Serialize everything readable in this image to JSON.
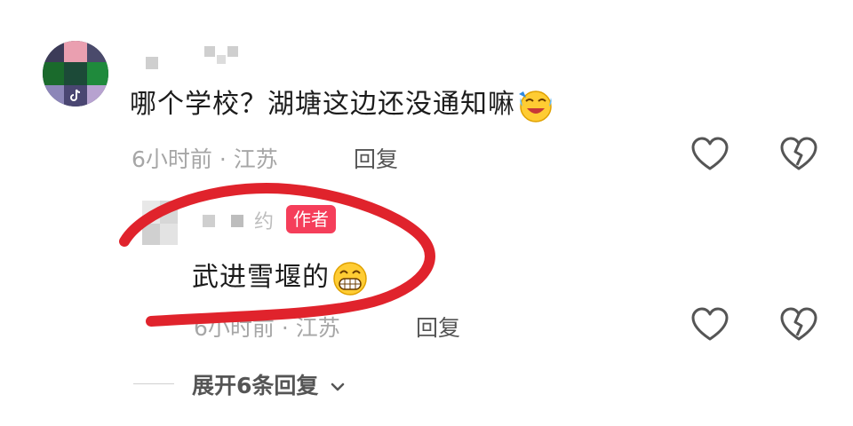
{
  "comment1": {
    "text": "哪个学校？湖塘这边还没通知嘛",
    "emoji": "laughing-crying-emoji",
    "time": "6小时前",
    "location": "江苏",
    "separator": "·",
    "reply_label": "回复"
  },
  "comment2": {
    "username_fragment": "约",
    "badge": "作者",
    "text": "武进雪堰的",
    "emoji": "grinning-emoji",
    "time": "6小时前",
    "separator": "·",
    "location": "江苏",
    "reply_label": "回复"
  },
  "expand": {
    "label": "展开6条回复",
    "icon": "chevron-down-icon"
  },
  "colors": {
    "badge": "#f53e5a",
    "annotation_stroke": "#e0232c"
  }
}
